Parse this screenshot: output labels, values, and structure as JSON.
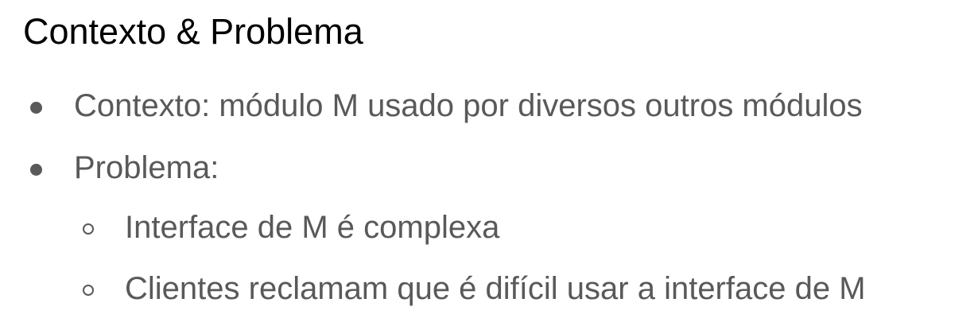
{
  "slide": {
    "title": "Contexto & Problema",
    "items": [
      {
        "level": 1,
        "text": "Contexto: módulo M usado por diversos outros módulos"
      },
      {
        "level": 1,
        "text": "Problema:"
      },
      {
        "level": 2,
        "text": "Interface de M é complexa"
      },
      {
        "level": 2,
        "text": "Clientes reclamam que é difícil usar a interface de M"
      }
    ]
  },
  "colors": {
    "title": "#000000",
    "body": "#595959",
    "background": "#ffffff"
  }
}
